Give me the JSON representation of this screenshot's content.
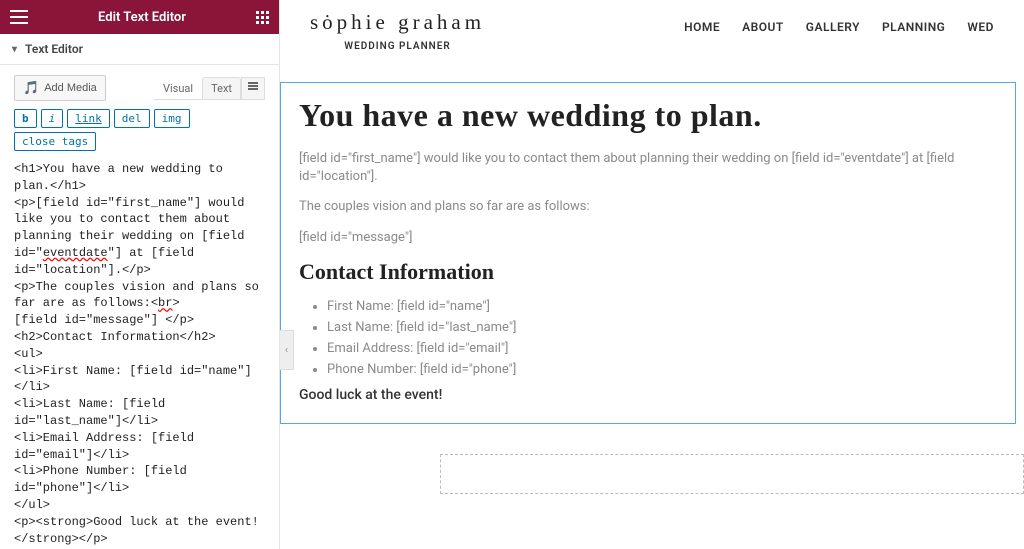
{
  "header": {
    "title": "Edit Text Editor"
  },
  "accordion": {
    "label": "Text Editor"
  },
  "media": {
    "add_label": "Add Media"
  },
  "tabs": {
    "visual": "Visual",
    "text": "Text"
  },
  "quicktags": {
    "b": "b",
    "i": "i",
    "link": "link",
    "del": "del",
    "img": "img",
    "close": "close tags"
  },
  "code": {
    "l1": "<h1>You have a new wedding to plan.</h1>",
    "l2": "<p>[field id=\"first_name\"] would like you to contact them about planning their wedding on [field id=\"",
    "l2err": "eventdate",
    "l2b": "\"] at [field id=\"location\"].</p>",
    "l3": "<p>The couples vision and plans so far are as follows:<",
    "l3err": "br",
    "l3b": ">",
    "l4": "[field id=\"message\"] </p>",
    "l5": "<h2>Contact Information</h2>",
    "l6": "<ul>",
    "l7": "<li>First Name: [field id=\"name\"]</li>",
    "l8": "<li>Last Name: [field id=\"last_name\"]</li>",
    "l9": "<li>Email Address: [field id=\"email\"]</li>",
    "l10": "<li>Phone Number: [field id=\"phone\"]</li>",
    "l11": "</ul>",
    "l12": "<p><strong>Good luck at the event!</strong></p>"
  },
  "site": {
    "logo": "sȯphie graham",
    "tagline": "WEDDING PLANNER",
    "nav": {
      "home": "HOME",
      "about": "ABOUT",
      "gallery": "GALLERY",
      "planning": "PLANNING",
      "wed": "WED"
    }
  },
  "content": {
    "h1": "You have a new wedding to plan.",
    "p1": "[field id=\"first_name\"] would like you to contact them about planning their wedding on [field id=\"eventdate\"] at [field id=\"location\"].",
    "p2": "The couples vision and plans so far are as follows:",
    "p3": "[field id=\"message\"]",
    "h2": "Contact Information",
    "li1": "First Name: [field id=\"name\"]",
    "li2": "Last Name: [field id=\"last_name\"]",
    "li3": "Email Address: [field id=\"email\"]",
    "li4": "Phone Number: [field id=\"phone\"]",
    "goodluck": "Good luck at the event!"
  }
}
